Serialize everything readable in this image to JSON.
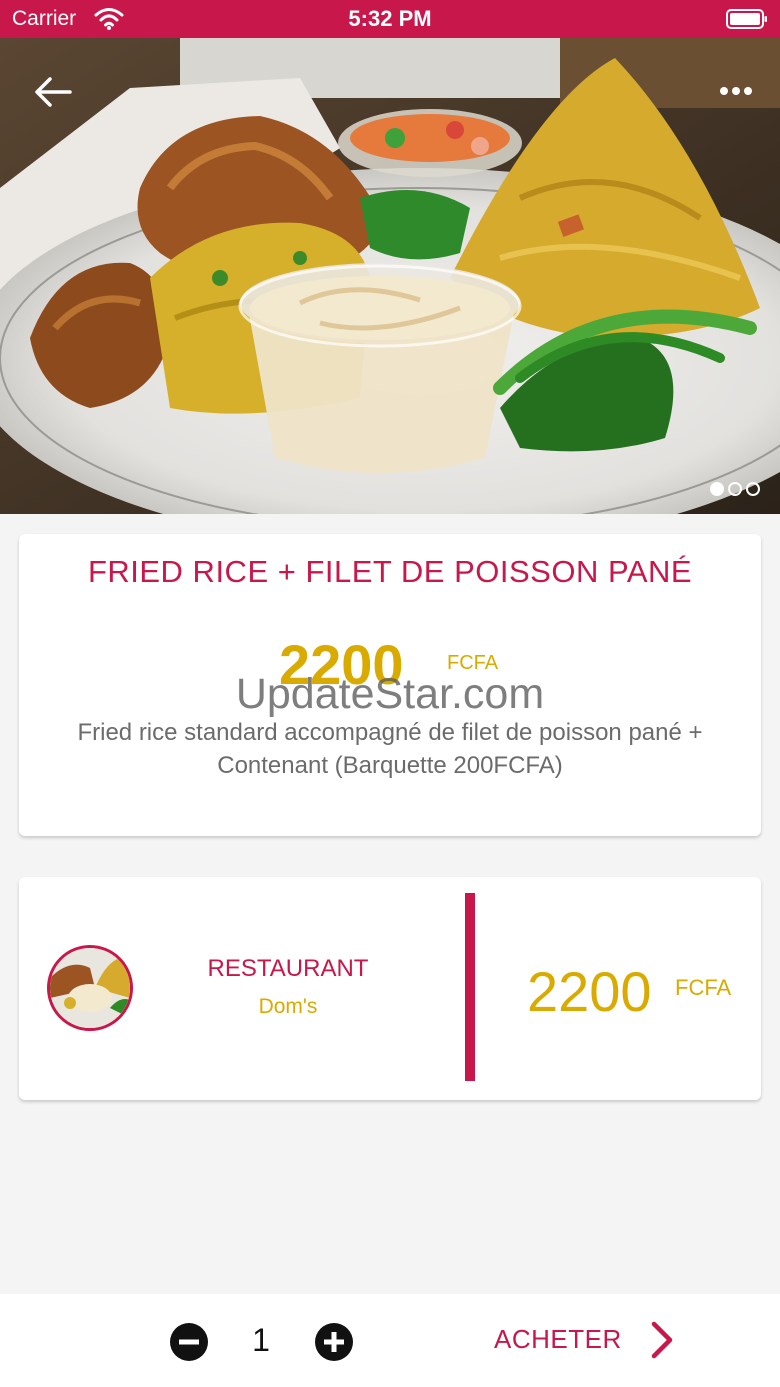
{
  "status_bar": {
    "carrier": "Carrier",
    "time": "5:32 PM",
    "icons": [
      "wifi-icon",
      "battery-icon"
    ]
  },
  "header": {
    "back_icon": "arrow-left-icon",
    "menu_icon": "more-horizontal-icon",
    "carousel": {
      "total_pages": 3,
      "current_page": 1
    }
  },
  "product": {
    "title": "FRIED RICE + FILET DE POISSON PANÉ",
    "price": "2200",
    "currency": "FCFA",
    "watermark": "UpdateStar.com",
    "description": "Fried rice standard accompagné de filet de poisson pané + Contenant (Barquette 200FCFA)"
  },
  "restaurant": {
    "label": "RESTAURANT",
    "name": "Dom's",
    "price": "2200",
    "currency": "FCFA"
  },
  "order": {
    "quantity": "1",
    "buy_label": "ACHETER",
    "icons": [
      "minus-circle-icon",
      "plus-circle-icon",
      "chevron-right-icon"
    ]
  },
  "colors": {
    "accent": "#c8174a",
    "price": "#d9ab00",
    "text_gray": "#6b6b6b",
    "background": "#f4f4f4"
  }
}
